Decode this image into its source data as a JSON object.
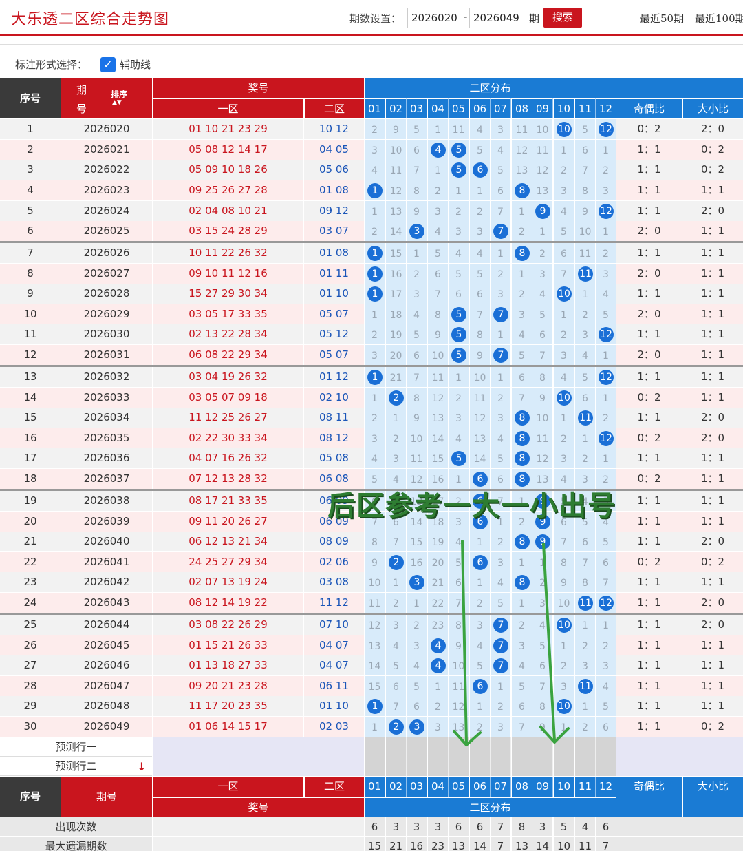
{
  "header": {
    "title": "大乐透二区综合走势图",
    "period_label": "期数设置：",
    "period_start": "2026020",
    "period_end": "2026049",
    "dash": "-",
    "period_unit": "期",
    "search_label": "搜索",
    "link_50": "最近50期",
    "link_100": "最近100期"
  },
  "options": {
    "label": "标注形式选择：",
    "check_mark": "✓",
    "guide_label": "辅助线"
  },
  "table_header": {
    "seq": "序号",
    "period_top": "期",
    "period_bottom": "号",
    "sort": "排序",
    "prize": "奖号",
    "zone1": "一区",
    "zone2": "二区",
    "zone2_dist": "二区分布",
    "odd_even": "奇偶比",
    "big_small": "大小比",
    "cols": [
      "01",
      "02",
      "03",
      "04",
      "05",
      "06",
      "07",
      "08",
      "09",
      "10",
      "11",
      "12"
    ]
  },
  "rows": [
    {
      "seq": "1",
      "period": "2026020",
      "front": "01 10 21 23 29",
      "back": "10 12",
      "cells": [
        "2",
        "9",
        "5",
        "1",
        "11",
        "4",
        "3",
        "11",
        "10",
        "10",
        "5",
        "12"
      ],
      "hits": [
        10,
        12
      ],
      "oe": "0：2",
      "bs": "2：0"
    },
    {
      "seq": "2",
      "period": "2026021",
      "front": "05 08 12 14 17",
      "back": "04 05",
      "cells": [
        "3",
        "10",
        "6",
        "4",
        "5",
        "5",
        "4",
        "12",
        "11",
        "1",
        "6",
        "1"
      ],
      "hits": [
        4,
        5
      ],
      "oe": "1：1",
      "bs": "0：2"
    },
    {
      "seq": "3",
      "period": "2026022",
      "front": "05 09 10 18 26",
      "back": "05 06",
      "cells": [
        "4",
        "11",
        "7",
        "1",
        "5",
        "6",
        "5",
        "13",
        "12",
        "2",
        "7",
        "2"
      ],
      "hits": [
        5,
        6
      ],
      "oe": "1：1",
      "bs": "0：2"
    },
    {
      "seq": "4",
      "period": "2026023",
      "front": "09 25 26 27 28",
      "back": "01 08",
      "cells": [
        "1",
        "12",
        "8",
        "2",
        "1",
        "1",
        "6",
        "8",
        "13",
        "3",
        "8",
        "3"
      ],
      "hits": [
        1,
        8
      ],
      "oe": "1：1",
      "bs": "1：1"
    },
    {
      "seq": "5",
      "period": "2026024",
      "front": "02 04 08 10 21",
      "back": "09 12",
      "cells": [
        "1",
        "13",
        "9",
        "3",
        "2",
        "2",
        "7",
        "1",
        "9",
        "4",
        "9",
        "12"
      ],
      "hits": [
        9,
        12
      ],
      "oe": "1：1",
      "bs": "2：0"
    },
    {
      "seq": "6",
      "period": "2026025",
      "front": "03 15 24 28 29",
      "back": "03 07",
      "cells": [
        "2",
        "14",
        "3",
        "4",
        "3",
        "3",
        "7",
        "2",
        "1",
        "5",
        "10",
        "1"
      ],
      "hits": [
        3,
        7
      ],
      "oe": "2：0",
      "bs": "1：1"
    },
    {
      "seq": "7",
      "period": "2026026",
      "front": "10 11 22 26 32",
      "back": "01 08",
      "cells": [
        "1",
        "15",
        "1",
        "5",
        "4",
        "4",
        "1",
        "8",
        "2",
        "6",
        "11",
        "2"
      ],
      "hits": [
        1,
        8
      ],
      "oe": "1：1",
      "bs": "1：1"
    },
    {
      "seq": "8",
      "period": "2026027",
      "front": "09 10 11 12 16",
      "back": "01 11",
      "cells": [
        "1",
        "16",
        "2",
        "6",
        "5",
        "5",
        "2",
        "1",
        "3",
        "7",
        "11",
        "3"
      ],
      "hits": [
        1,
        11
      ],
      "oe": "2：0",
      "bs": "1：1"
    },
    {
      "seq": "9",
      "period": "2026028",
      "front": "15 27 29 30 34",
      "back": "01 10",
      "cells": [
        "1",
        "17",
        "3",
        "7",
        "6",
        "6",
        "3",
        "2",
        "4",
        "10",
        "1",
        "4"
      ],
      "hits": [
        1,
        10
      ],
      "oe": "1：1",
      "bs": "1：1"
    },
    {
      "seq": "10",
      "period": "2026029",
      "front": "03 05 17 33 35",
      "back": "05 07",
      "cells": [
        "1",
        "18",
        "4",
        "8",
        "5",
        "7",
        "7",
        "3",
        "5",
        "1",
        "2",
        "5"
      ],
      "hits": [
        5,
        7
      ],
      "oe": "2：0",
      "bs": "1：1"
    },
    {
      "seq": "11",
      "period": "2026030",
      "front": "02 13 22 28 34",
      "back": "05 12",
      "cells": [
        "2",
        "19",
        "5",
        "9",
        "5",
        "8",
        "1",
        "4",
        "6",
        "2",
        "3",
        "12"
      ],
      "hits": [
        5,
        12
      ],
      "oe": "1：1",
      "bs": "1：1"
    },
    {
      "seq": "12",
      "period": "2026031",
      "front": "06 08 22 29 34",
      "back": "05 07",
      "cells": [
        "3",
        "20",
        "6",
        "10",
        "5",
        "9",
        "7",
        "5",
        "7",
        "3",
        "4",
        "1"
      ],
      "hits": [
        5,
        7
      ],
      "oe": "2：0",
      "bs": "1：1"
    },
    {
      "seq": "13",
      "period": "2026032",
      "front": "03 04 19 26 32",
      "back": "01 12",
      "cells": [
        "1",
        "21",
        "7",
        "11",
        "1",
        "10",
        "1",
        "6",
        "8",
        "4",
        "5",
        "12"
      ],
      "hits": [
        1,
        12
      ],
      "oe": "1：1",
      "bs": "1：1"
    },
    {
      "seq": "14",
      "period": "2026033",
      "front": "03 05 07 09 18",
      "back": "02 10",
      "cells": [
        "1",
        "2",
        "8",
        "12",
        "2",
        "11",
        "2",
        "7",
        "9",
        "10",
        "6",
        "1"
      ],
      "hits": [
        2,
        10
      ],
      "oe": "0：2",
      "bs": "1：1"
    },
    {
      "seq": "15",
      "period": "2026034",
      "front": "11 12 25 26 27",
      "back": "08 11",
      "cells": [
        "2",
        "1",
        "9",
        "13",
        "3",
        "12",
        "3",
        "8",
        "10",
        "1",
        "11",
        "2"
      ],
      "hits": [
        8,
        11
      ],
      "oe": "1：1",
      "bs": "2：0"
    },
    {
      "seq": "16",
      "period": "2026035",
      "front": "02 22 30 33 34",
      "back": "08 12",
      "cells": [
        "3",
        "2",
        "10",
        "14",
        "4",
        "13",
        "4",
        "8",
        "11",
        "2",
        "1",
        "12"
      ],
      "hits": [
        8,
        12
      ],
      "oe": "0：2",
      "bs": "2：0"
    },
    {
      "seq": "17",
      "period": "2026036",
      "front": "04 07 16 26 32",
      "back": "05 08",
      "cells": [
        "4",
        "3",
        "11",
        "15",
        "5",
        "14",
        "5",
        "8",
        "12",
        "3",
        "2",
        "1"
      ],
      "hits": [
        5,
        8
      ],
      "oe": "1：1",
      "bs": "1：1"
    },
    {
      "seq": "18",
      "period": "2026037",
      "front": "07 12 13 28 32",
      "back": "06 08",
      "cells": [
        "5",
        "4",
        "12",
        "16",
        "1",
        "6",
        "6",
        "8",
        "13",
        "4",
        "3",
        "2"
      ],
      "hits": [
        6,
        8
      ],
      "oe": "0：2",
      "bs": "1：1"
    },
    {
      "seq": "19",
      "period": "2026038",
      "front": "08 17 21 33 35",
      "back": "06 09",
      "cells": [
        "6",
        "5",
        "13",
        "17",
        "2",
        "6",
        "7",
        "1",
        "9",
        "5",
        "4",
        "3"
      ],
      "hits": [
        6,
        9
      ],
      "oe": "1：1",
      "bs": "1：1"
    },
    {
      "seq": "20",
      "period": "2026039",
      "front": "09 11 20 26 27",
      "back": "06 09",
      "cells": [
        "7",
        "6",
        "14",
        "18",
        "3",
        "6",
        "1",
        "2",
        "9",
        "6",
        "5",
        "4"
      ],
      "hits": [
        6,
        9
      ],
      "oe": "1：1",
      "bs": "1：1"
    },
    {
      "seq": "21",
      "period": "2026040",
      "front": "06 12 13 21 34",
      "back": "08 09",
      "cells": [
        "8",
        "7",
        "15",
        "19",
        "4",
        "1",
        "2",
        "8",
        "9",
        "7",
        "6",
        "5"
      ],
      "hits": [
        8,
        9
      ],
      "oe": "1：1",
      "bs": "2：0"
    },
    {
      "seq": "22",
      "period": "2026041",
      "front": "24 25 27 29 34",
      "back": "02 06",
      "cells": [
        "9",
        "2",
        "16",
        "20",
        "5",
        "6",
        "3",
        "1",
        "1",
        "8",
        "7",
        "6"
      ],
      "hits": [
        2,
        6
      ],
      "oe": "0：2",
      "bs": "0：2"
    },
    {
      "seq": "23",
      "period": "2026042",
      "front": "02 07 13 19 24",
      "back": "03 08",
      "cells": [
        "10",
        "1",
        "3",
        "21",
        "6",
        "1",
        "4",
        "8",
        "2",
        "9",
        "8",
        "7"
      ],
      "hits": [
        3,
        8
      ],
      "oe": "1：1",
      "bs": "1：1"
    },
    {
      "seq": "24",
      "period": "2026043",
      "front": "08 12 14 19 22",
      "back": "11 12",
      "cells": [
        "11",
        "2",
        "1",
        "22",
        "7",
        "2",
        "5",
        "1",
        "3",
        "10",
        "11",
        "12"
      ],
      "hits": [
        11,
        12
      ],
      "oe": "1：1",
      "bs": "2：0"
    },
    {
      "seq": "25",
      "period": "2026044",
      "front": "03 08 22 26 29",
      "back": "07 10",
      "cells": [
        "12",
        "3",
        "2",
        "23",
        "8",
        "3",
        "7",
        "2",
        "4",
        "10",
        "1",
        "1"
      ],
      "hits": [
        7,
        10
      ],
      "oe": "1：1",
      "bs": "2：0"
    },
    {
      "seq": "26",
      "period": "2026045",
      "front": "01 15 21 26 33",
      "back": "04 07",
      "cells": [
        "13",
        "4",
        "3",
        "4",
        "9",
        "4",
        "7",
        "3",
        "5",
        "1",
        "2",
        "2"
      ],
      "hits": [
        4,
        7
      ],
      "oe": "1：1",
      "bs": "1：1"
    },
    {
      "seq": "27",
      "period": "2026046",
      "front": "01 13 18 27 33",
      "back": "04 07",
      "cells": [
        "14",
        "5",
        "4",
        "4",
        "10",
        "5",
        "7",
        "4",
        "6",
        "2",
        "3",
        "3"
      ],
      "hits": [
        4,
        7
      ],
      "oe": "1：1",
      "bs": "1：1"
    },
    {
      "seq": "28",
      "period": "2026047",
      "front": "09 20 21 23 28",
      "back": "06 11",
      "cells": [
        "15",
        "6",
        "5",
        "1",
        "11",
        "6",
        "1",
        "5",
        "7",
        "3",
        "11",
        "4"
      ],
      "hits": [
        6,
        11
      ],
      "oe": "1：1",
      "bs": "1：1"
    },
    {
      "seq": "29",
      "period": "2026048",
      "front": "11 17 20 23 35",
      "back": "01 10",
      "cells": [
        "1",
        "7",
        "6",
        "2",
        "12",
        "1",
        "2",
        "6",
        "8",
        "10",
        "1",
        "5"
      ],
      "hits": [
        1,
        10
      ],
      "oe": "1：1",
      "bs": "1：1"
    },
    {
      "seq": "30",
      "period": "2026049",
      "front": "01 06 14 15 17",
      "back": "02 03",
      "cells": [
        "1",
        "2",
        "3",
        "3",
        "13",
        "2",
        "3",
        "7",
        "9",
        "1",
        "2",
        "6"
      ],
      "hits": [
        2,
        3
      ],
      "oe": "1：1",
      "bs": "0：2"
    }
  ],
  "predict": {
    "row1": "预测行一",
    "row2": "预测行二",
    "arrow": "↓"
  },
  "footer_header": {
    "seq": "序号",
    "period": "期号",
    "zone1": "一区",
    "zone2": "二区",
    "prize": "奖号",
    "zone2_dist": "二区分布",
    "odd_even": "奇偶比",
    "big_small": "大小比"
  },
  "stats": {
    "count_label": "出现次数",
    "count_values": [
      "6",
      "3",
      "3",
      "3",
      "6",
      "6",
      "7",
      "8",
      "3",
      "5",
      "4",
      "6"
    ],
    "max_omit_label": "最大遗漏期数",
    "max_omit_values": [
      "15",
      "21",
      "16",
      "23",
      "13",
      "14",
      "7",
      "13",
      "14",
      "10",
      "11",
      "7"
    ]
  },
  "annotation": "后区参考一大一小出号",
  "colors": {
    "brand_red": "#c9151e",
    "ball_blue": "#1a6fd6",
    "header_blue": "#1a7bd4",
    "annotation_green": "#2e7d32"
  }
}
